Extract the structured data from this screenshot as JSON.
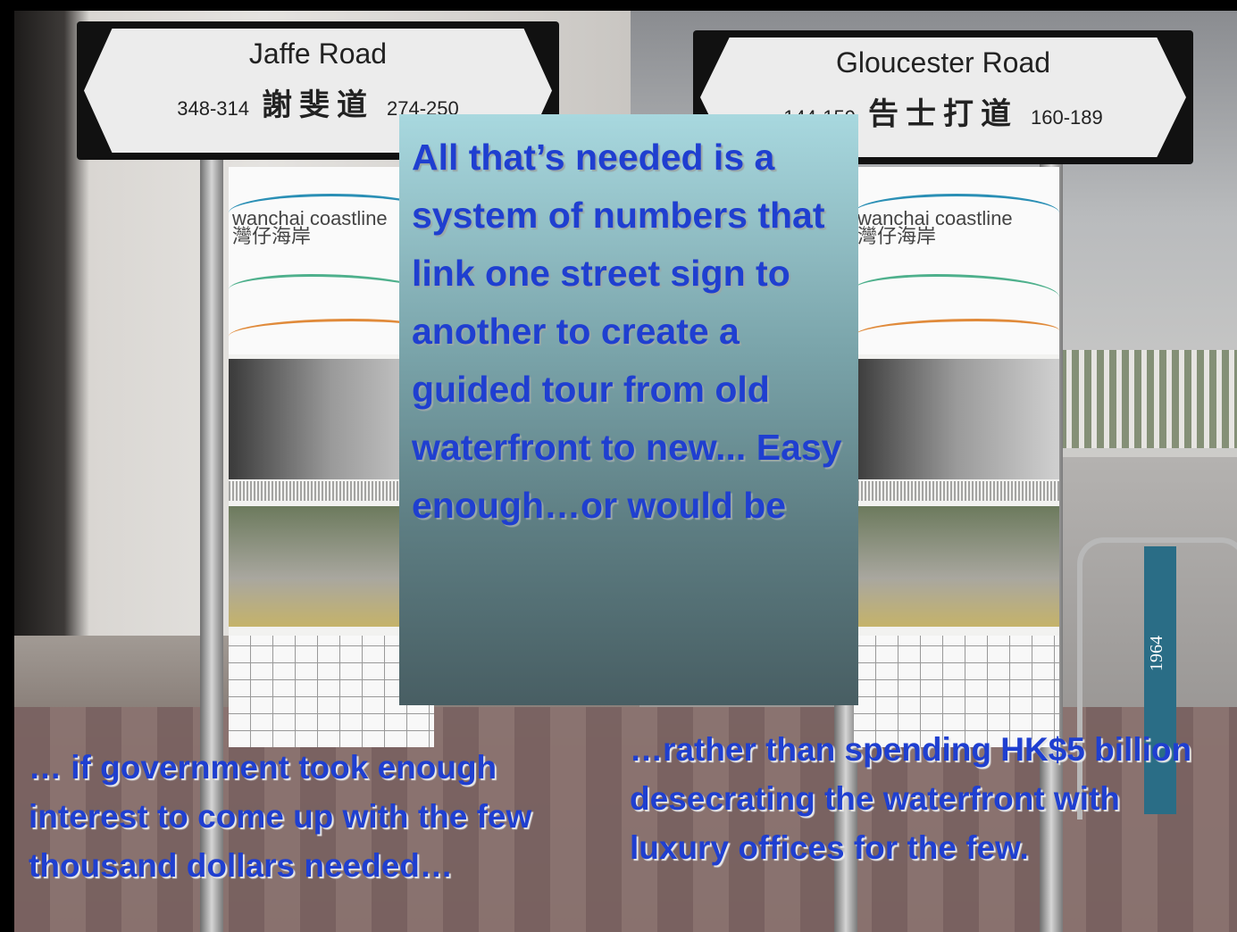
{
  "signs": {
    "left": {
      "title": "Jaffe Road",
      "left_numbers": "348-314",
      "chinese": "謝斐道",
      "right_numbers": "274-250"
    },
    "right": {
      "title": "Gloucester Road",
      "left_numbers": "144-159",
      "chinese": "告士打道",
      "right_numbers": "160-189"
    }
  },
  "panels": {
    "brand_en": "wanchai coastline",
    "brand_zh": "灣仔海岸"
  },
  "post_label": "1964",
  "caption": "All that’s needed is a system of numbers that link one street sign to another to create a guided tour from old waterfront to new... Easy enough…or would be",
  "notes": {
    "left": "… if government took enough interest to come up with the few thousand dollars needed…",
    "right": "…rather than spending HK$5 billion desecrating the waterfront with luxury offices for the few."
  }
}
